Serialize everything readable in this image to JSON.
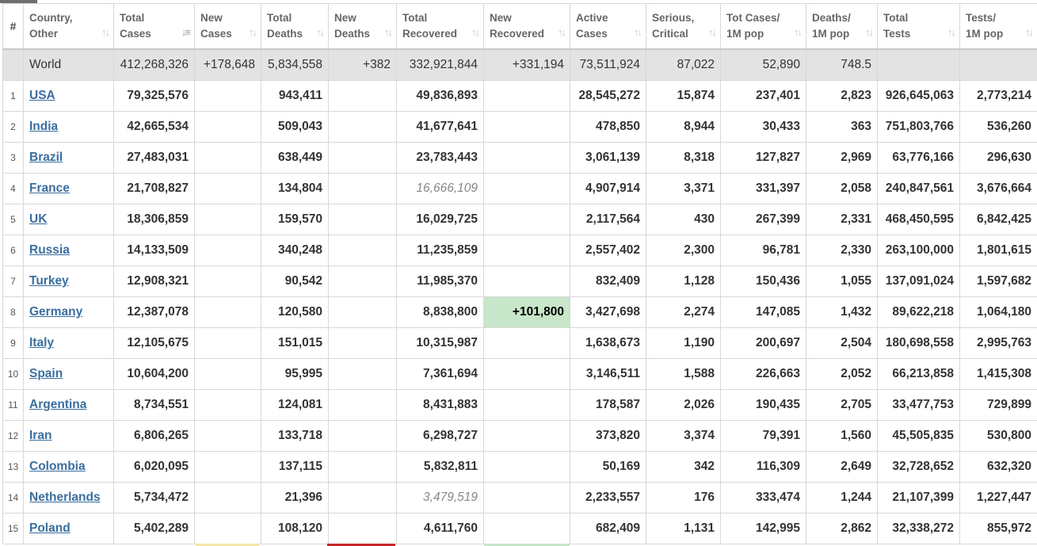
{
  "columns": [
    {
      "line1": "#",
      "line2": ""
    },
    {
      "line1": "Country,",
      "line2": "Other"
    },
    {
      "line1": "Total",
      "line2": "Cases"
    },
    {
      "line1": "New",
      "line2": "Cases"
    },
    {
      "line1": "Total",
      "line2": "Deaths"
    },
    {
      "line1": "New",
      "line2": "Deaths"
    },
    {
      "line1": "Total",
      "line2": "Recovered"
    },
    {
      "line1": "New",
      "line2": "Recovered"
    },
    {
      "line1": "Active",
      "line2": "Cases"
    },
    {
      "line1": "Serious,",
      "line2": "Critical"
    },
    {
      "line1": "Tot Cases/",
      "line2": "1M pop"
    },
    {
      "line1": "Deaths/",
      "line2": "1M pop"
    },
    {
      "line1": "Total",
      "line2": "Tests"
    },
    {
      "line1": "Tests/",
      "line2": "1M pop"
    }
  ],
  "world": {
    "name": "World",
    "total_cases": "412,268,326",
    "new_cases": "+178,648",
    "total_deaths": "5,834,558",
    "new_deaths": "+382",
    "total_recovered": "332,921,844",
    "new_recovered": "+331,194",
    "active_cases": "73,511,924",
    "serious": "87,022",
    "cases_per_1m": "52,890",
    "deaths_per_1m": "748.5",
    "total_tests": "",
    "tests_per_1m": ""
  },
  "rows": [
    {
      "idx": "1",
      "country": "USA",
      "total_cases": "79,325,576",
      "new_cases": "",
      "total_deaths": "943,411",
      "new_deaths": "",
      "total_recovered": "49,836,893",
      "new_recovered": "",
      "active_cases": "28,545,272",
      "serious": "15,874",
      "cases_per_1m": "237,401",
      "deaths_per_1m": "2,823",
      "total_tests": "926,645,063",
      "tests_per_1m": "2,773,214"
    },
    {
      "idx": "2",
      "country": "India",
      "total_cases": "42,665,534",
      "new_cases": "",
      "total_deaths": "509,043",
      "new_deaths": "",
      "total_recovered": "41,677,641",
      "new_recovered": "",
      "active_cases": "478,850",
      "serious": "8,944",
      "cases_per_1m": "30,433",
      "deaths_per_1m": "363",
      "total_tests": "751,803,766",
      "tests_per_1m": "536,260"
    },
    {
      "idx": "3",
      "country": "Brazil",
      "total_cases": "27,483,031",
      "new_cases": "",
      "total_deaths": "638,449",
      "new_deaths": "",
      "total_recovered": "23,783,443",
      "new_recovered": "",
      "active_cases": "3,061,139",
      "serious": "8,318",
      "cases_per_1m": "127,827",
      "deaths_per_1m": "2,969",
      "total_tests": "63,776,166",
      "tests_per_1m": "296,630"
    },
    {
      "idx": "4",
      "country": "France",
      "total_cases": "21,708,827",
      "new_cases": "",
      "total_deaths": "134,804",
      "new_deaths": "",
      "total_recovered": "16,666,109",
      "new_recovered": "",
      "active_cases": "4,907,914",
      "serious": "3,371",
      "cases_per_1m": "331,397",
      "deaths_per_1m": "2,058",
      "total_tests": "240,847,561",
      "tests_per_1m": "3,676,664"
    },
    {
      "idx": "5",
      "country": "UK",
      "total_cases": "18,306,859",
      "new_cases": "",
      "total_deaths": "159,570",
      "new_deaths": "",
      "total_recovered": "16,029,725",
      "new_recovered": "",
      "active_cases": "2,117,564",
      "serious": "430",
      "cases_per_1m": "267,399",
      "deaths_per_1m": "2,331",
      "total_tests": "468,450,595",
      "tests_per_1m": "6,842,425"
    },
    {
      "idx": "6",
      "country": "Russia",
      "total_cases": "14,133,509",
      "new_cases": "",
      "total_deaths": "340,248",
      "new_deaths": "",
      "total_recovered": "11,235,859",
      "new_recovered": "",
      "active_cases": "2,557,402",
      "serious": "2,300",
      "cases_per_1m": "96,781",
      "deaths_per_1m": "2,330",
      "total_tests": "263,100,000",
      "tests_per_1m": "1,801,615"
    },
    {
      "idx": "7",
      "country": "Turkey",
      "total_cases": "12,908,321",
      "new_cases": "",
      "total_deaths": "90,542",
      "new_deaths": "",
      "total_recovered": "11,985,370",
      "new_recovered": "",
      "active_cases": "832,409",
      "serious": "1,128",
      "cases_per_1m": "150,436",
      "deaths_per_1m": "1,055",
      "total_tests": "137,091,024",
      "tests_per_1m": "1,597,682"
    },
    {
      "idx": "8",
      "country": "Germany",
      "total_cases": "12,387,078",
      "new_cases": "",
      "total_deaths": "120,580",
      "new_deaths": "",
      "total_recovered": "8,838,800",
      "new_recovered": "+101,800",
      "active_cases": "3,427,698",
      "serious": "2,274",
      "cases_per_1m": "147,085",
      "deaths_per_1m": "1,432",
      "total_tests": "89,622,218",
      "tests_per_1m": "1,064,180"
    },
    {
      "idx": "9",
      "country": "Italy",
      "total_cases": "12,105,675",
      "new_cases": "",
      "total_deaths": "151,015",
      "new_deaths": "",
      "total_recovered": "10,315,987",
      "new_recovered": "",
      "active_cases": "1,638,673",
      "serious": "1,190",
      "cases_per_1m": "200,697",
      "deaths_per_1m": "2,504",
      "total_tests": "180,698,558",
      "tests_per_1m": "2,995,763"
    },
    {
      "idx": "10",
      "country": "Spain",
      "total_cases": "10,604,200",
      "new_cases": "",
      "total_deaths": "95,995",
      "new_deaths": "",
      "total_recovered": "7,361,694",
      "new_recovered": "",
      "active_cases": "3,146,511",
      "serious": "1,588",
      "cases_per_1m": "226,663",
      "deaths_per_1m": "2,052",
      "total_tests": "66,213,858",
      "tests_per_1m": "1,415,308"
    },
    {
      "idx": "11",
      "country": "Argentina",
      "total_cases": "8,734,551",
      "new_cases": "",
      "total_deaths": "124,081",
      "new_deaths": "",
      "total_recovered": "8,431,883",
      "new_recovered": "",
      "active_cases": "178,587",
      "serious": "2,026",
      "cases_per_1m": "190,435",
      "deaths_per_1m": "2,705",
      "total_tests": "33,477,753",
      "tests_per_1m": "729,899"
    },
    {
      "idx": "12",
      "country": "Iran",
      "total_cases": "6,806,265",
      "new_cases": "",
      "total_deaths": "133,718",
      "new_deaths": "",
      "total_recovered": "6,298,727",
      "new_recovered": "",
      "active_cases": "373,820",
      "serious": "3,374",
      "cases_per_1m": "79,391",
      "deaths_per_1m": "1,560",
      "total_tests": "45,505,835",
      "tests_per_1m": "530,800"
    },
    {
      "idx": "13",
      "country": "Colombia",
      "total_cases": "6,020,095",
      "new_cases": "",
      "total_deaths": "137,115",
      "new_deaths": "",
      "total_recovered": "5,832,811",
      "new_recovered": "",
      "active_cases": "50,169",
      "serious": "342",
      "cases_per_1m": "116,309",
      "deaths_per_1m": "2,649",
      "total_tests": "32,728,652",
      "tests_per_1m": "632,320"
    },
    {
      "idx": "14",
      "country": "Netherlands",
      "total_cases": "5,734,472",
      "new_cases": "",
      "total_deaths": "21,396",
      "new_deaths": "",
      "total_recovered": "3,479,519",
      "new_recovered": "",
      "active_cases": "2,233,557",
      "serious": "176",
      "cases_per_1m": "333,474",
      "deaths_per_1m": "1,244",
      "total_tests": "21,107,399",
      "tests_per_1m": "1,227,447"
    },
    {
      "idx": "15",
      "country": "Poland",
      "total_cases": "5,402,289",
      "new_cases": "",
      "total_deaths": "108,120",
      "new_deaths": "",
      "total_recovered": "4,611,760",
      "new_recovered": "",
      "active_cases": "682,409",
      "serious": "1,131",
      "cases_per_1m": "142,995",
      "deaths_per_1m": "2,862",
      "total_tests": "32,338,272",
      "tests_per_1m": "855,972"
    }
  ],
  "highlight": {
    "new_recovered_row": "Germany",
    "italic_recovered_rows": [
      "France",
      "Netherlands"
    ]
  },
  "colors": {
    "world_row_bg": "#e3e3e3",
    "new_recovered_bg": "#c8e6c9",
    "link": "#3a6e9f",
    "header_text": "#666666",
    "italic_value": "#888888",
    "new_cases_bar": "#f5e6a8",
    "new_deaths_bar": "#c62828",
    "new_recovered_bar": "#c8e6c9"
  }
}
